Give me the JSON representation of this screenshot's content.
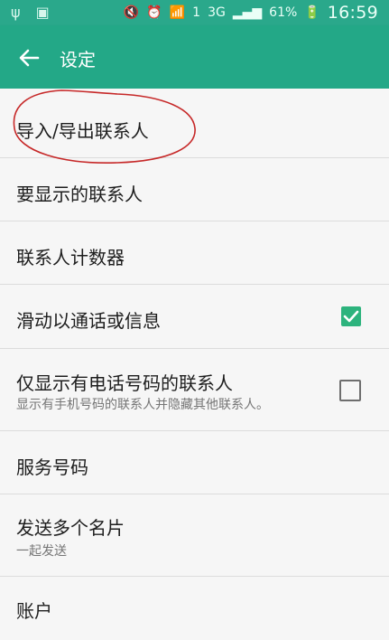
{
  "status_bar": {
    "time": "16:59",
    "battery": "61%",
    "network": "3G",
    "sim": "1",
    "icons": [
      "usb-icon",
      "image-icon",
      "mute-icon",
      "alarm-icon",
      "wifi-icon",
      "signal-icon",
      "battery-icon"
    ]
  },
  "app_bar": {
    "title": "设定",
    "back_icon": "arrow-left-icon",
    "background": "#23a887"
  },
  "settings": [
    {
      "label": "导入/导出联系人"
    },
    {
      "label": "要显示的联系人"
    },
    {
      "label": "联系人计数器"
    },
    {
      "label": "滑动以通话或信息",
      "checkbox": true
    },
    {
      "label": "仅显示有电话号码的联系人",
      "subtitle": "显示有手机号码的联系人并隐藏其他联系人。",
      "checkbox": false
    },
    {
      "label": "服务号码"
    },
    {
      "label": "发送多个名片",
      "subtitle": "一起发送"
    },
    {
      "label": "账户"
    }
  ],
  "colors": {
    "accent": "#23a887",
    "checkbox_checked": "#2db37d",
    "annotation": "#c62828"
  }
}
